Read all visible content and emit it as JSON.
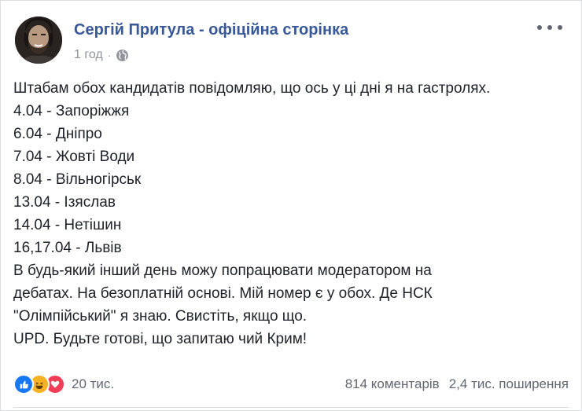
{
  "post": {
    "author": "Сергій Притула - офіційна сторінка",
    "time": "1 год",
    "separator": "·",
    "privacy_icon": "globe-icon",
    "more_icon": "more-options-icon",
    "lines": [
      "Штабам обох кандидатів повідомляю, що ось у ці дні я на гастролях.",
      "4.04 - Запоріжжя",
      "6.04 - Дніпро",
      "7.04 - Жовті Води",
      "8.04 - Вільногірськ",
      "13.04 - Ізяслав",
      "14.04 - Нетішин",
      "16,17.04 - Львів",
      "В будь-який інший день можу попрацювати модератором на",
      "дебатах. На безоплатній основі. Мій номер є у обох. Де НСК",
      "\"Олімпійський\" я знаю. Свистіть, якщо що.",
      "UPD. Будьте готові, що запитаю чий Крим!"
    ]
  },
  "footer": {
    "reactions": [
      "like",
      "haha",
      "love"
    ],
    "reaction_count": "20 тис.",
    "comments": "814 коментарів",
    "shares": "2,4 тис. поширення"
  },
  "colors": {
    "author": "#385898",
    "meta": "#90949c",
    "like": "#1877f2",
    "haha": "#f7b125",
    "love": "#f33e58"
  }
}
